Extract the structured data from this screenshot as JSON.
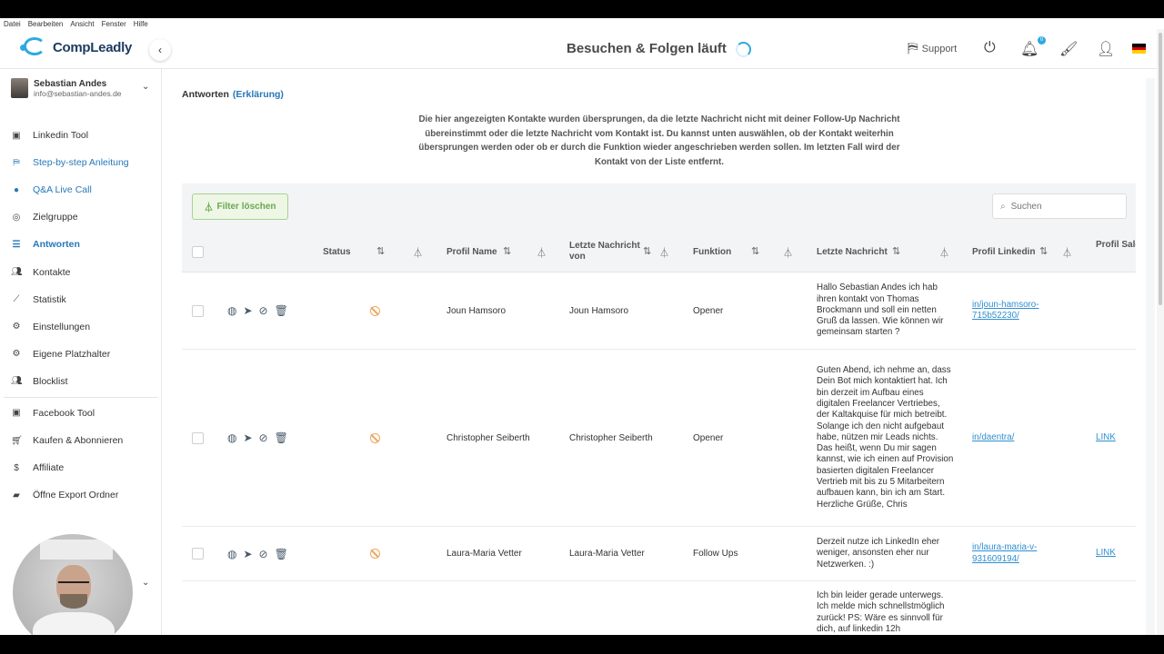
{
  "app_menu": [
    "Datei",
    "Bearbeiten",
    "Ansicht",
    "Fenster",
    "Hilfe"
  ],
  "brand": {
    "name": "CompLeadly",
    "accent": "#2fa8e0"
  },
  "header": {
    "status_title": "Besuchen & Folgen läuft",
    "support_label": "Support",
    "notification_count": "0",
    "language_flag": "de"
  },
  "user": {
    "name": "Sebastian Andes",
    "email": "info@sebastian-andes.de"
  },
  "sidebar": {
    "items": [
      {
        "label": "Linkedin Tool",
        "icon": "linkedin-icon",
        "state": "normal"
      },
      {
        "label": "Step-by-step Anleitung",
        "icon": "steps-icon",
        "state": "blue"
      },
      {
        "label": "Q&A Live Call",
        "icon": "question-icon",
        "state": "blue"
      },
      {
        "label": "Zielgruppe",
        "icon": "target-icon",
        "state": "normal"
      },
      {
        "label": "Antworten",
        "icon": "replies-icon",
        "state": "active"
      },
      {
        "label": "Kontakte",
        "icon": "contacts-icon",
        "state": "normal"
      },
      {
        "label": "Statistik",
        "icon": "chart-icon",
        "state": "normal"
      },
      {
        "label": "Einstellungen",
        "icon": "gear-icon",
        "state": "normal"
      },
      {
        "label": "Eigene Platzhalter",
        "icon": "placeholder-icon",
        "state": "normal"
      },
      {
        "label": "Blocklist",
        "icon": "blocklist-icon",
        "state": "normal"
      },
      {
        "label": "Facebook Tool",
        "icon": "facebook-icon",
        "state": "normal"
      },
      {
        "label": "Kaufen & Abonnieren",
        "icon": "cart-icon",
        "state": "normal"
      },
      {
        "label": "Affiliate",
        "icon": "dollar-icon",
        "state": "normal"
      },
      {
        "label": "Öffne Export Ordner",
        "icon": "folder-icon",
        "state": "normal"
      }
    ]
  },
  "page": {
    "title": "Antworten",
    "explanation_link": "(Erklärung)",
    "info_text": "Die hier angezeigten Kontakte wurden übersprungen, da die letzte Nachricht nicht mit deiner Follow-Up Nachricht übereinstimmt oder die letzte Nachricht vom Kontakt ist. Du kannst unten auswählen, ob der Kontakt weiterhin übersprungen werden oder ob er durch die Funktion wieder angeschrieben werden sollen. Im letzten Fall wird der Kontakt von der Liste entfernt.",
    "filter_button": "Filter löschen",
    "search_placeholder": "Suchen"
  },
  "table": {
    "columns": {
      "status": "Status",
      "profile_name": "Profil Name",
      "last_message_from": "Letzte Nachricht von",
      "function": "Funktion",
      "last_message": "Letzte Nachricht",
      "profile_linkedin": "Profil Linkedin",
      "sales_navigator": "Profil Sales Navigator"
    },
    "rows": [
      {
        "profile_name": "Joun Hamsoro",
        "last_message_from": "Joun Hamsoro",
        "function": "Opener",
        "last_message": "Hallo Sebastian Andes ich hab ihren kontakt von Thomas Brockmann und soll ein netten Gruß da lassen. Wie können wir gemeinsam starten ?",
        "profile_linkedin": "in/joun-hamsoro-715b52230/",
        "sales_navigator": ""
      },
      {
        "profile_name": "Christopher Seiberth",
        "last_message_from": "Christopher Seiberth",
        "function": "Opener",
        "last_message": "Guten Abend, ich nehme an, dass Dein Bot mich kontaktiert hat. Ich bin derzeit im Aufbau eines digitalen Freelancer Vertriebes, der Kaltakquise für mich betreibt. Solange ich den nicht aufgebaut habe, nützen mir Leads nichts. Das heißt, wenn Du mir sagen kannst, wie ich einen auf Provision basierten digitalen Freelancer Vertrieb mit bis zu 5 Mitarbeitern aufbauen kann, bin ich am Start. Herzliche Grüße, Chris",
        "profile_linkedin": "in/daentra/",
        "sales_navigator": "LINK"
      },
      {
        "profile_name": "Laura-Maria Vetter",
        "last_message_from": "Laura-Maria Vetter",
        "function": "Follow Ups",
        "last_message": "Derzeit nutze ich LinkedIn eher weniger, ansonsten eher nur Netzwerken. :)",
        "profile_linkedin": "in/laura-maria-v-931609194/",
        "sales_navigator": "LINK"
      },
      {
        "profile_name": "",
        "last_message_from": "",
        "function": "",
        "last_message": "Ich bin leider gerade unterwegs. Ich melde mich schnellstmöglich zurück! PS: Wäre es sinnvoll für dich, auf linkedin 12h",
        "profile_linkedin": "",
        "sales_navigator": ""
      }
    ]
  }
}
